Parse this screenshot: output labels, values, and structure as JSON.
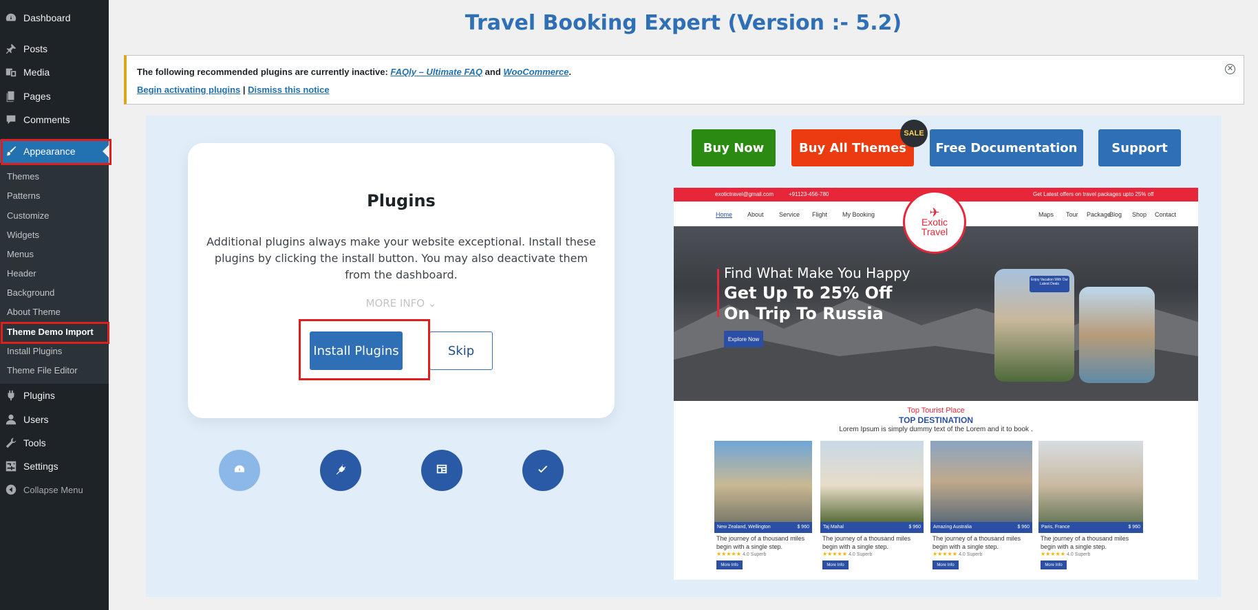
{
  "sidebar": {
    "items": [
      {
        "label": "Dashboard",
        "icon": "dashboard-icon"
      },
      {
        "label": "Posts",
        "icon": "pin-icon"
      },
      {
        "label": "Media",
        "icon": "media-icon"
      },
      {
        "label": "Pages",
        "icon": "pages-icon"
      },
      {
        "label": "Comments",
        "icon": "comment-icon"
      },
      {
        "label": "Appearance",
        "icon": "brush-icon"
      },
      {
        "label": "Plugins",
        "icon": "plug-icon"
      },
      {
        "label": "Users",
        "icon": "user-icon"
      },
      {
        "label": "Tools",
        "icon": "wrench-icon"
      },
      {
        "label": "Settings",
        "icon": "settings-icon"
      },
      {
        "label": "Collapse Menu",
        "icon": "collapse-icon"
      }
    ],
    "submenu": [
      "Themes",
      "Patterns",
      "Customize",
      "Widgets",
      "Menus",
      "Header",
      "Background",
      "About Theme",
      "Theme Demo Import",
      "Install Plugins",
      "Theme File Editor"
    ]
  },
  "header": {
    "title": "Travel Booking Expert (Version :- 5.2)"
  },
  "notice": {
    "text_before": "The following recommended plugins are currently inactive: ",
    "link1": "FAQly – Ultimate FAQ",
    "and": " and ",
    "link2": "WooCommerce",
    "period": ".",
    "activate": "Begin activating plugins",
    "sep": " | ",
    "dismiss": "Dismiss this notice"
  },
  "card": {
    "title": "Plugins",
    "description": "Additional plugins always make your website exceptional. Install these plugins by clicking the install button. You may also deactivate them from the dashboard.",
    "more_info": "MORE INFO",
    "install": "Install Plugins",
    "skip": "Skip"
  },
  "buttons": {
    "buy_now": "Buy Now",
    "buy_all": "Buy All Themes",
    "sale": "SALE",
    "docs": "Free Documentation",
    "support": "Support"
  },
  "preview": {
    "email": "exotictravel@gmail.com",
    "phone": "+91123-456-780",
    "offer": "Get Latest offers on travel packages upto 25% off",
    "nav_left": [
      "Home",
      "About",
      "Service",
      "Flight",
      "My Booking"
    ],
    "nav_right": [
      "Maps",
      "Tour",
      "Package",
      "Blog",
      "Shop",
      "Contact"
    ],
    "logo1": "Exotic",
    "logo2": "Travel",
    "hero_line1": "Find What Make You Happy",
    "hero_line2": "Get Up To 25% Off",
    "hero_line3": "On Trip To Russia",
    "explore": "Explore Now",
    "tag": "Enjoy Vacation With Our Latest Deals",
    "sub1": "Top Tourist Place",
    "sub2": "TOP DESTINATION",
    "sub3": "Lorem Ipsum is simply dummy text of the Lorem  and  it to book .",
    "destinations": [
      {
        "name": "New Zealand, Wellington",
        "price": "$ 960"
      },
      {
        "name": "Taj Mahal",
        "price": "$ 960"
      },
      {
        "name": "Amazing Australia",
        "price": "$ 960"
      },
      {
        "name": "Paris, France",
        "price": "$ 960"
      }
    ],
    "dest_desc": "The journey of a thousand miles begin with a single step.",
    "rating": "4.0 Superb",
    "more_info": "More Info"
  },
  "colors": {
    "accent": "#2f6fb5",
    "buy_now": "#2b8a12",
    "buy_all": "#ec3b10",
    "highlight": "#e01e1e",
    "sidebar": "#1d2327"
  }
}
